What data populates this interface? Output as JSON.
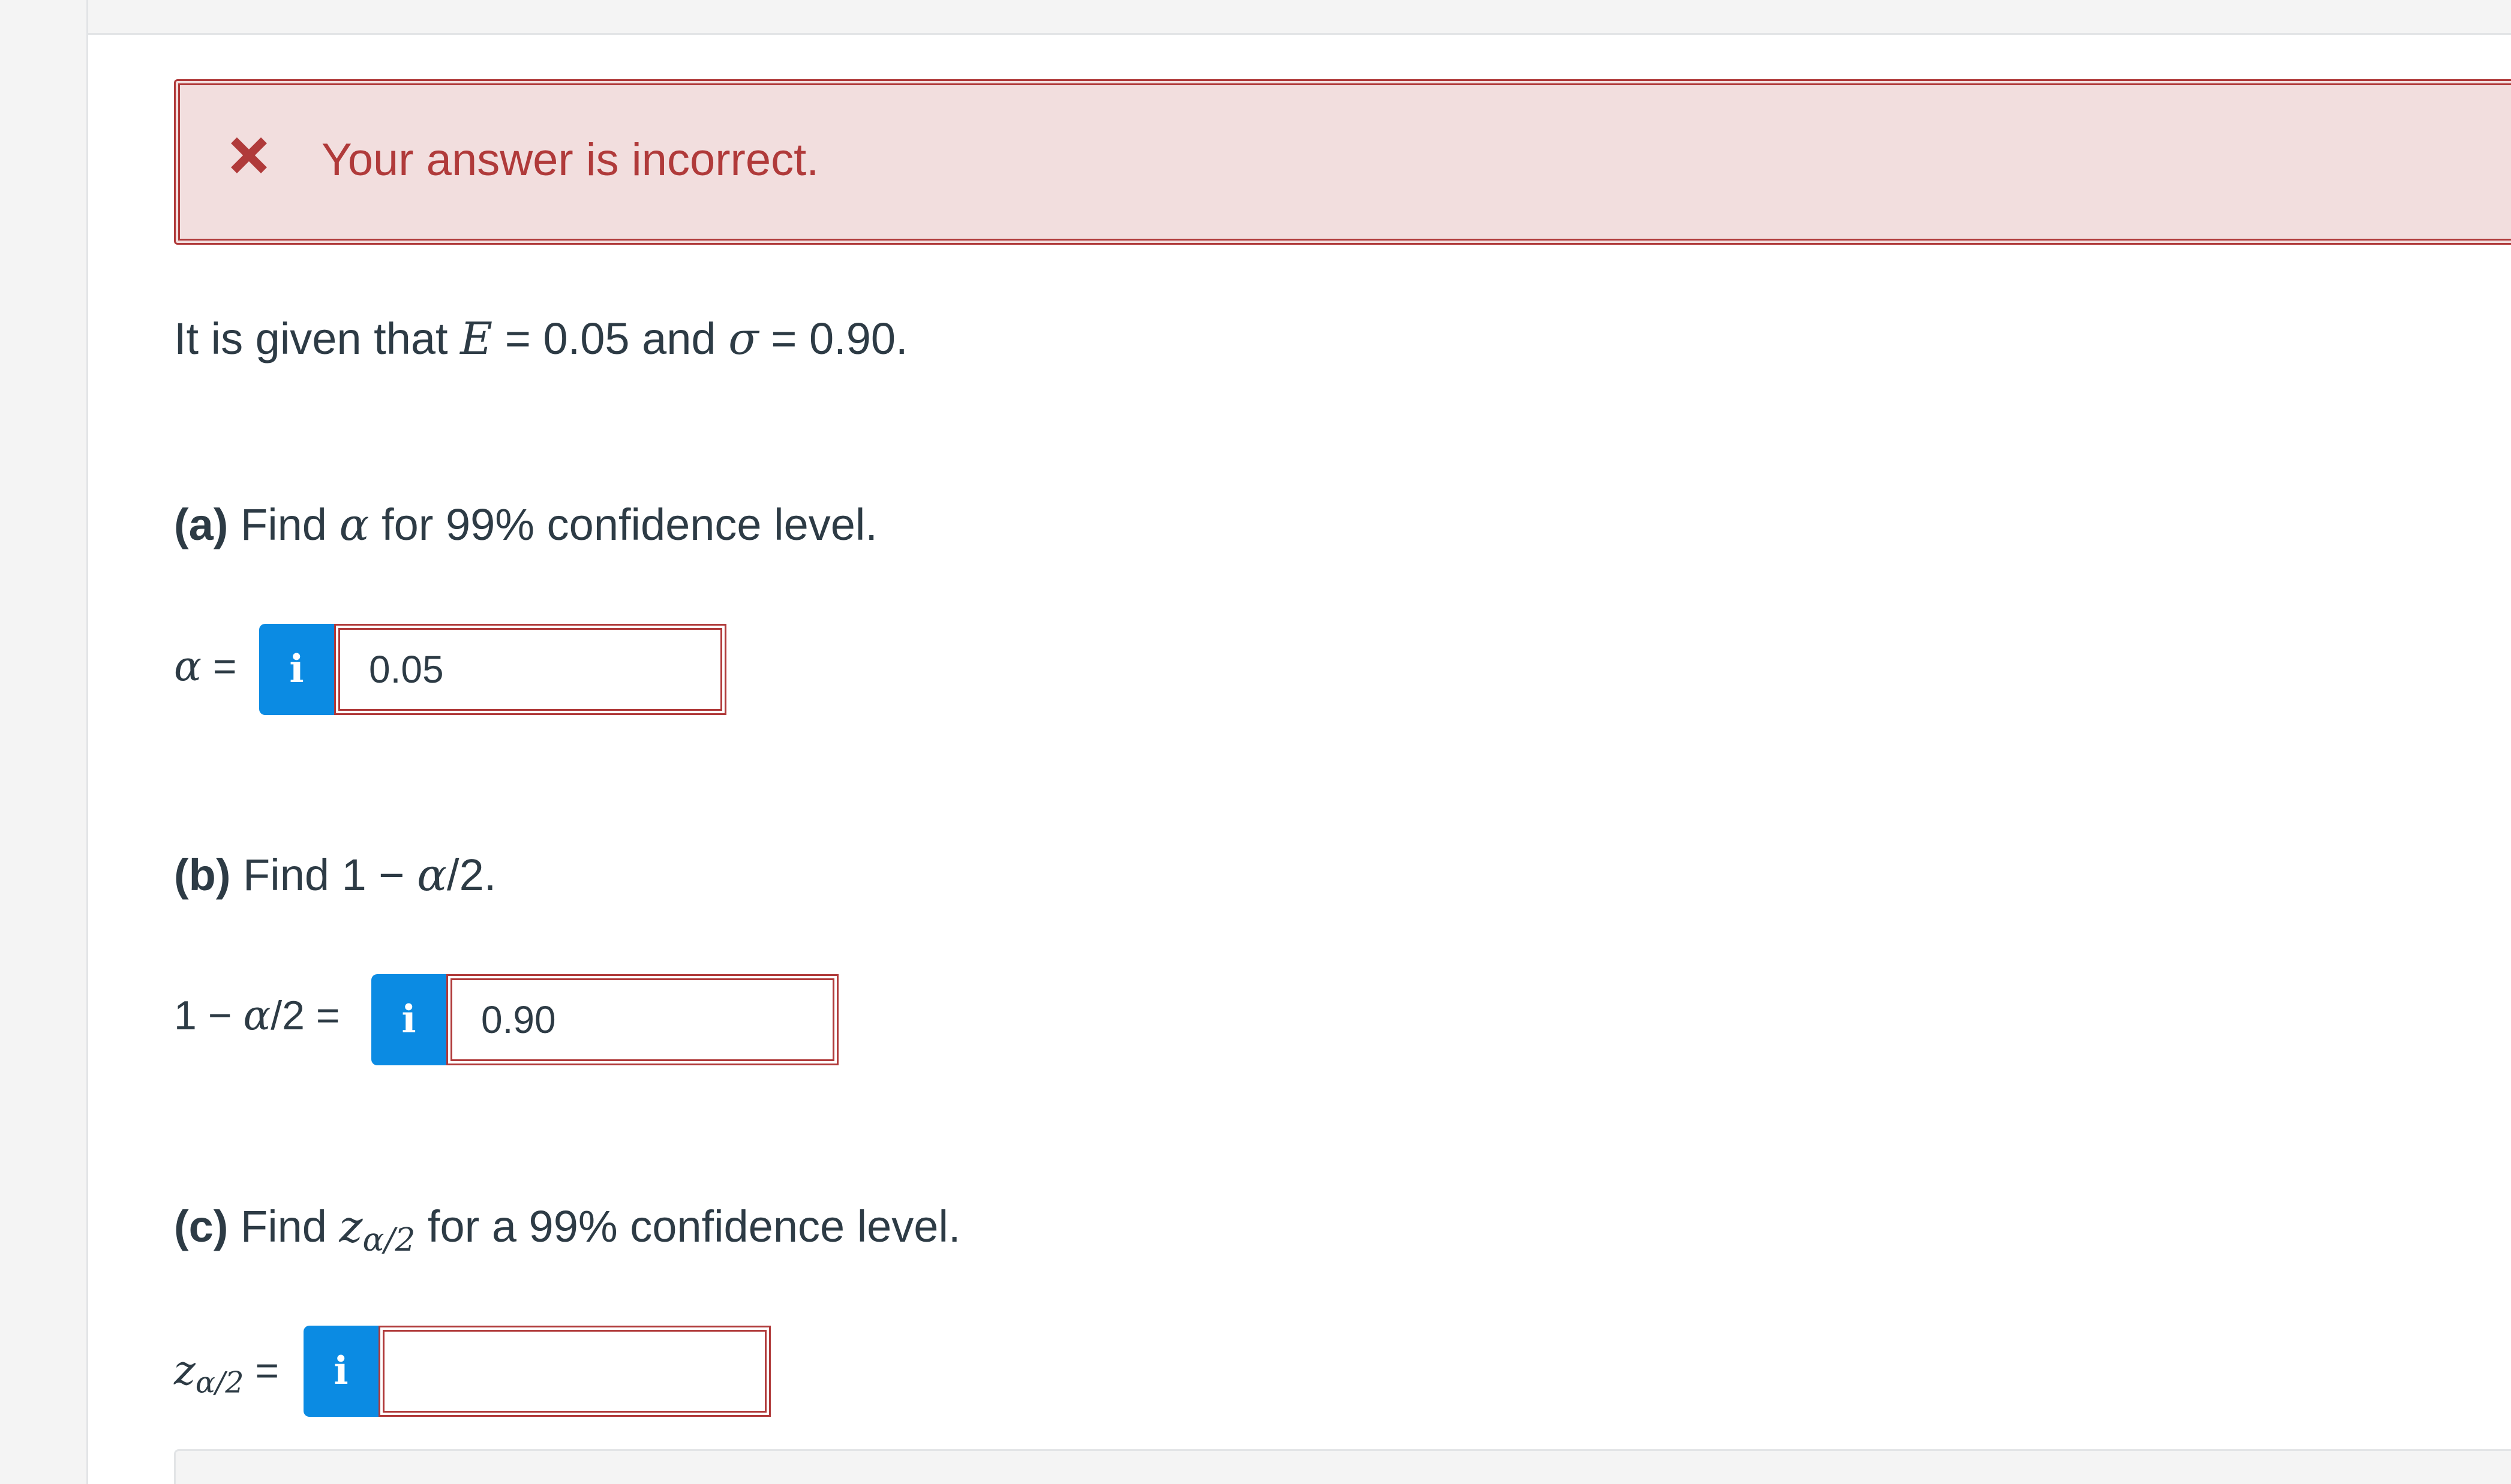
{
  "feedback": {
    "message": "Your answer is incorrect.",
    "icon": "close-icon",
    "color": "#b03a3a"
  },
  "given": {
    "prefix": "It is given that ",
    "var1": "E",
    "eq1": " = 0.05 and ",
    "var2": "σ",
    "eq2": " = 0.90."
  },
  "part_a": {
    "letter": "(a)",
    "q_prefix": " Find ",
    "q_var": "α",
    "q_suffix": " for 99% confidence level.",
    "label_var": "α",
    "label_eq": " =",
    "answer": "0.05"
  },
  "part_b": {
    "letter": "(b)",
    "q_prefix": " Find 1 − ",
    "q_var": "α",
    "q_suffix": "/2.",
    "label_prefix": "1 − ",
    "label_var": "α",
    "label_suffix": "/2 =",
    "answer": "0.90"
  },
  "part_c": {
    "letter": "(c)",
    "q_prefix": " Find ",
    "q_var": "z",
    "q_sub": "α/2",
    "q_suffix": " for a 99% confidence level.",
    "label_var": "z",
    "label_sub": "α/2",
    "label_eq": " =",
    "answer": ""
  },
  "info_button_glyph": "i",
  "colors": {
    "error": "#b03a3a",
    "error_bg": "#f2dede",
    "info_button": "#0b8be3",
    "text": "#2d3b45"
  }
}
